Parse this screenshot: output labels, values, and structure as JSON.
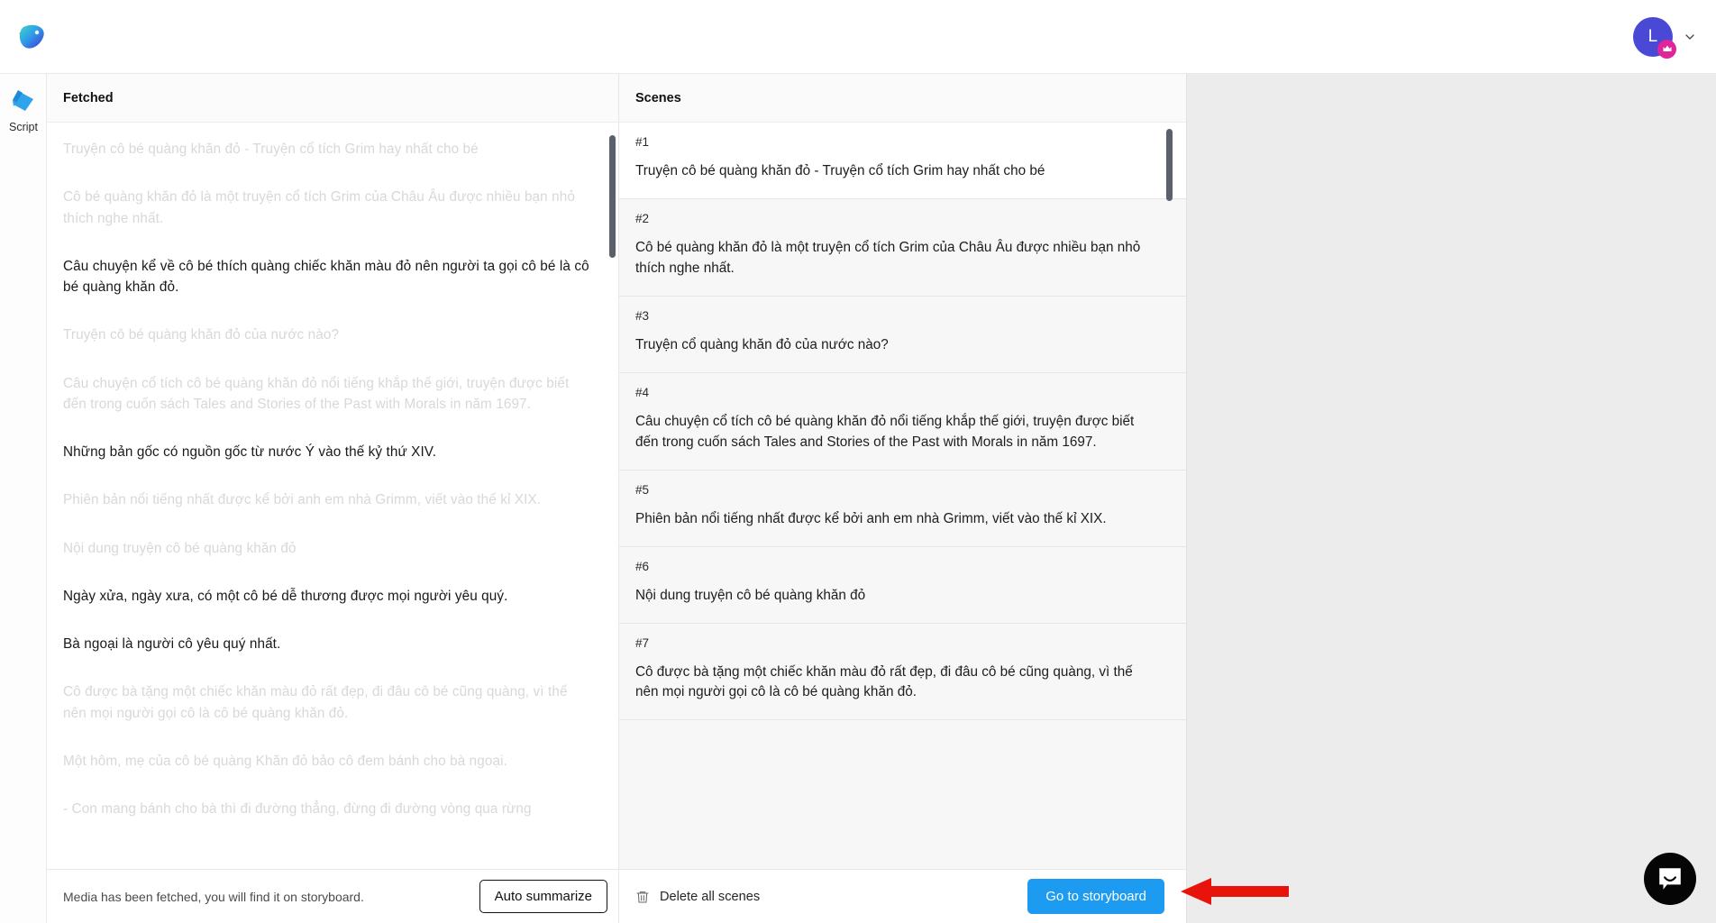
{
  "app": {
    "logo_name": "app-logo",
    "accent_blue": "#1d9bf0",
    "avatar_bg": "#4949d6",
    "crown_bg": "#e0249a",
    "arrow_color": "#e8140c"
  },
  "topbar": {
    "avatar_initial": "L",
    "badge_icon": "crown-icon",
    "chevron_icon": "chevron-down-icon"
  },
  "sidebar": {
    "items": [
      {
        "label": "Script",
        "icon": "script-pen-icon"
      }
    ]
  },
  "fetched_panel": {
    "title": "Fetched",
    "paragraphs": [
      {
        "text": "Truyện cô bé quàng khăn đỏ - Truyện cổ tích Grim hay nhất cho bé",
        "active": false
      },
      {
        "text": "Cô bé quàng khăn đỏ là một truyện cổ tích Grim của Châu Âu được nhiều bạn nhỏ thích nghe nhất.",
        "active": false
      },
      {
        "text": "Câu chuyện kể về cô bé thích quàng chiếc khăn màu đỏ nên người ta gọi cô bé là cô bé quàng khăn đỏ.",
        "active": true
      },
      {
        "text": "Truyện cô bé quàng khăn đỏ của nước nào?",
        "active": false
      },
      {
        "text": "Câu chuyện cổ tích cô bé quàng khăn đỏ nổi tiếng khắp thế giới, truyện được biết đến trong cuốn sách Tales and Stories of the Past with Morals in năm 1697.",
        "active": false
      },
      {
        "text": "Những bản gốc có nguồn gốc từ nước Ý vào thế kỷ thứ XIV.",
        "active": true
      },
      {
        "text": "Phiên bản nổi tiếng nhất được kể bởi anh em nhà Grimm, viết vào thế kỉ XIX.",
        "active": false
      },
      {
        "text": "Nội dung truyện cô bé quàng khăn đỏ",
        "active": false
      },
      {
        "text": "Ngày xửa, ngày xưa, có một cô bé dễ thương được mọi người yêu quý.",
        "active": true
      },
      {
        "text": "Bà ngoại là người cô yêu quý nhất.",
        "active": true
      },
      {
        "text": "Cô được bà tặng một chiếc khăn màu đỏ rất đẹp, đi đâu cô bé cũng quàng, vì thế nên mọi người gọi cô là cô bé quàng khăn đỏ.",
        "active": false
      },
      {
        "text": "Một hôm, mẹ của cô bé quàng Khăn đỏ bảo cô đem bánh cho bà ngoại.",
        "active": false
      },
      {
        "text": "- Con mang bánh cho bà thì đi đường thẳng, đừng đi đường vòng qua rừng",
        "active": false
      }
    ],
    "footer_note": "Media has been fetched, you will find it on storyboard.",
    "auto_summarize_label": "Auto summarize"
  },
  "scenes_panel": {
    "title": "Scenes",
    "scenes": [
      {
        "num": "#1",
        "text": "Truyện cô bé quàng khăn đỏ - Truyện cổ tích Grim hay nhất cho bé",
        "selected": true
      },
      {
        "num": "#2",
        "text": "Cô bé quàng khăn đỏ là một truyện cổ tích Grim của Châu Âu được nhiều bạn nhỏ thích nghe nhất.",
        "selected": false
      },
      {
        "num": "#3",
        "text": "Truyện cổ quàng khăn đỏ của nước nào?",
        "selected": false
      },
      {
        "num": "#4",
        "text": " Câu chuyện cổ tích cô bé quàng khăn đỏ nổi tiếng khắp thế giới, truyện được biết đến trong cuốn sách Tales and Stories of the Past with Morals in năm 1697.",
        "selected": false
      },
      {
        "num": "#5",
        "text": " Phiên bản nổi tiếng nhất được kể bởi anh em nhà Grimm, viết vào thế kỉ XIX.",
        "selected": false
      },
      {
        "num": "#6",
        "text": "Nội dung truyện cô bé quàng khăn đỏ",
        "selected": false
      },
      {
        "num": "#7",
        "text": " Cô được bà tặng một chiếc khăn màu đỏ rất đẹp, đi đâu cô bé cũng quàng, vì thế nên mọi người gọi cô là cô bé quàng khăn đỏ.",
        "selected": false
      }
    ],
    "delete_all_label": "Delete all scenes",
    "delete_icon": "trash-icon",
    "go_storyboard_label": "Go to storyboard"
  },
  "annotation": {
    "arrow_icon": "left-arrow-annotation"
  },
  "help": {
    "launcher_icon": "chat-bubble-icon"
  }
}
